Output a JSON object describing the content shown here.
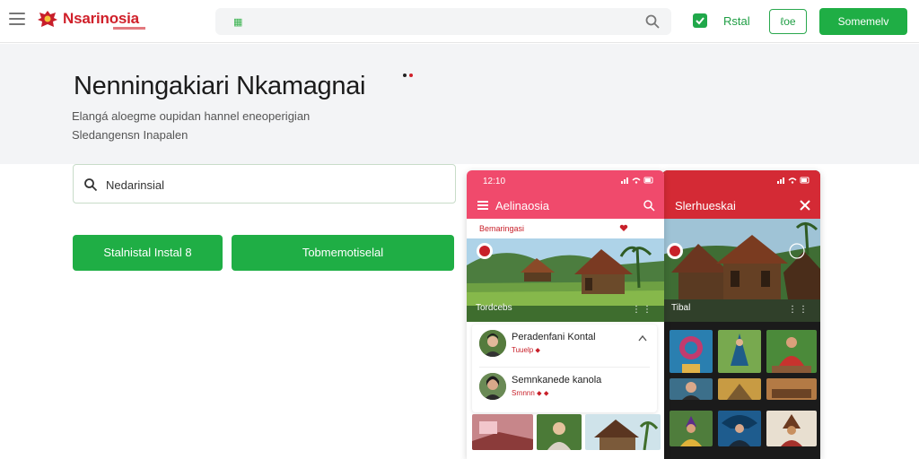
{
  "topbar": {
    "menu_icon": "hamburger-icon",
    "logo_text": "Nsarinosia",
    "search_value": "▦",
    "search_icon": "search-icon",
    "checkbox_icon": "check-icon",
    "install_link": "Rstal",
    "ghost_button": "ℓoe",
    "primary_button": "Somemelv"
  },
  "hero": {
    "title": "Nenningakiari Nkamagnai",
    "subtitle_line1": "Elangá aloegme oupidan hannel eneoperigian",
    "subtitle_line2": "Sledangensn Inapalen"
  },
  "actions": {
    "search_field_value": "Nedarinsial",
    "button_a": "Stalnistal Instal 8",
    "button_b": "Tobmemotiselal"
  },
  "phone_left": {
    "time": "12:10",
    "title": "Aelinaosia",
    "section_tag": "Bemaringasi",
    "scene_caption": "Tordcebs",
    "scene_more": "⋮⋮",
    "items": [
      {
        "name": "Peradenfani Kontal",
        "meta": "Tuuelp ⬥"
      },
      {
        "name": "Semnkanede kanola",
        "meta": "Srnnnn ⬥ ⬥"
      }
    ]
  },
  "phone_right": {
    "title": "Slerhueskai",
    "scene_caption": "Tibal",
    "scene_more": "⋮⋮"
  },
  "colors": {
    "brand_red": "#d0202a",
    "green": "#1fae45",
    "pink_header": "#f04a6c",
    "red_header": "#d42a35"
  }
}
